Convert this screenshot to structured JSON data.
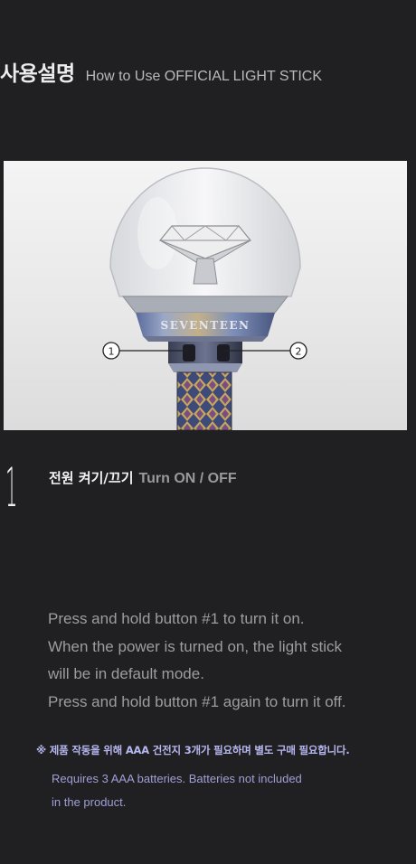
{
  "header": {
    "title_ko": "사용설명",
    "title_en": "How to Use OFFICIAL LIGHT STICK"
  },
  "product_image": {
    "brand_text": "SEVENTEEN",
    "callouts": [
      "①",
      "②"
    ]
  },
  "step": {
    "number": "1",
    "title_ko": "전원 켜기/끄기",
    "title_en": "Turn ON / OFF"
  },
  "instructions": [
    "Press and hold button #1 to turn it on.",
    "When the power is turned on, the light stick",
    "will be in default mode.",
    "Press and hold button #1 again to turn it off."
  ],
  "battery_note": {
    "ko": "※ 제품 작동을 위해 AAA 건전지 3개가 필요하며 별도 구매 필요합니다.",
    "en_lines": [
      "Requires 3 AAA batteries. Batteries not included",
      "in the product."
    ]
  },
  "colors": {
    "background": "#202022",
    "note_accent": "#b6b7f0"
  }
}
